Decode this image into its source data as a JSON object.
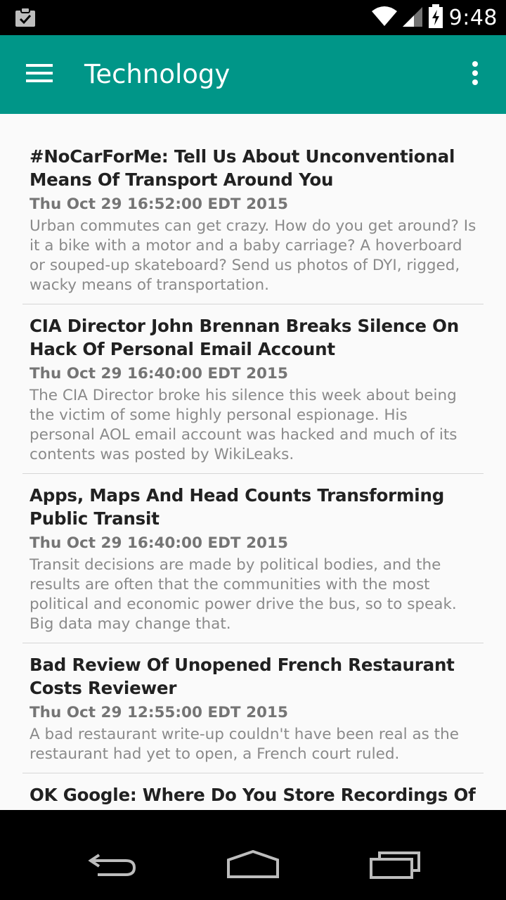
{
  "status_bar": {
    "time": "9:48",
    "icons": [
      "notification-clipboard-icon",
      "wifi-icon",
      "cell-signal-icon",
      "battery-charging-icon"
    ]
  },
  "app_bar": {
    "title": "Technology",
    "menu_icon": "hamburger-menu-icon",
    "overflow_icon": "overflow-menu-icon",
    "color": "#009688"
  },
  "articles": [
    {
      "title": "#NoCarForMe: Tell Us About Unconventional Means Of Transport Around You",
      "date": "Thu Oct 29 16:52:00 EDT 2015",
      "description": "Urban commutes can get crazy. How do you get around? Is it a bike with a motor and a baby carriage? A hoverboard or souped-up skateboard? Send us photos of DYI, rigged, wacky means of transportation."
    },
    {
      "title": "CIA Director John Brennan Breaks Silence On Hack Of Personal Email Account",
      "date": "Thu Oct 29 16:40:00 EDT 2015",
      "description": "The CIA Director broke his silence this week about being the victim of some highly personal espionage. His personal AOL email account was hacked and much of its contents was posted by WikiLeaks."
    },
    {
      "title": "Apps, Maps And Head Counts Transforming Public Transit",
      "date": "Thu Oct 29 16:40:00 EDT 2015",
      "description": "Transit decisions are made by political bodies, and the results are often that the communities with the most political and economic power drive the bus, so to speak. Big data may change that."
    },
    {
      "title": "Bad Review Of Unopened French Restaurant Costs Reviewer",
      "date": "Thu Oct 29 12:55:00 EDT 2015",
      "description": "A bad restaurant write-up couldn't have been real as the restaurant had yet to open, a French court ruled."
    },
    {
      "title": "OK Google: Where Do You Store Recordings Of My",
      "date": "",
      "description": ""
    }
  ],
  "nav_bar": {
    "buttons": [
      "back-icon",
      "home-icon",
      "recents-icon"
    ]
  }
}
